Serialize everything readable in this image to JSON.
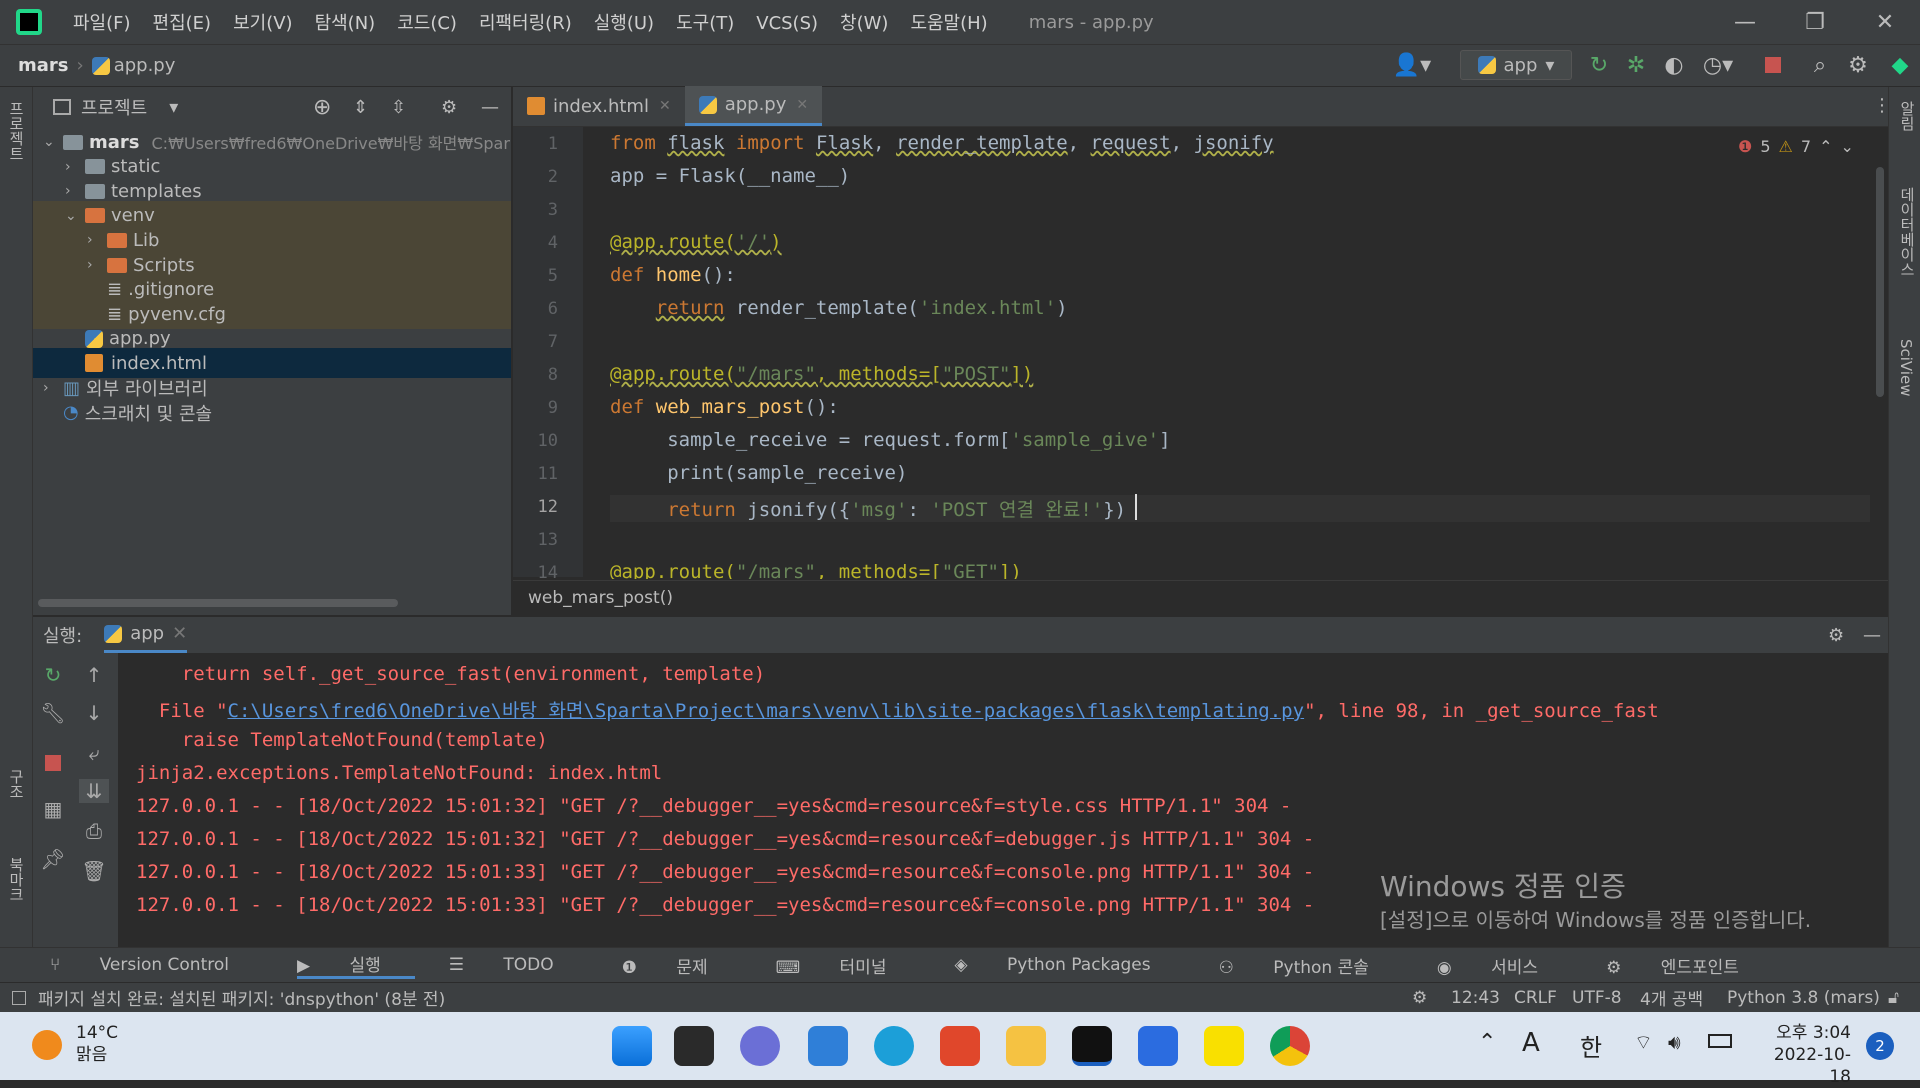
{
  "menu": [
    "파일(F)",
    "편집(E)",
    "보기(V)",
    "탐색(N)",
    "코드(C)",
    "리팩터링(R)",
    "실행(U)",
    "도구(T)",
    "VCS(S)",
    "창(W)",
    "도움말(H)"
  ],
  "window_title": "mars - app.py",
  "nav": {
    "project": "mars",
    "file": "app.py",
    "run_config": "app"
  },
  "project_panel": {
    "title": "프로젝트",
    "tree": [
      {
        "label": "mars",
        "path": "C:₩Users₩fred6₩OneDrive₩바탕 화면₩Spar",
        "level": 0,
        "type": "folder",
        "expanded": true
      },
      {
        "label": "static",
        "level": 1,
        "type": "folder"
      },
      {
        "label": "templates",
        "level": 1,
        "type": "folder"
      },
      {
        "label": "venv",
        "level": 1,
        "type": "folder-orange",
        "expanded": true
      },
      {
        "label": "Lib",
        "level": 2,
        "type": "folder-orange"
      },
      {
        "label": "Scripts",
        "level": 2,
        "type": "folder-orange"
      },
      {
        "label": ".gitignore",
        "level": 2,
        "type": "file"
      },
      {
        "label": "pyvenv.cfg",
        "level": 2,
        "type": "file"
      },
      {
        "label": "app.py",
        "level": 1,
        "type": "py"
      },
      {
        "label": "index.html",
        "level": 1,
        "type": "html",
        "selected": true
      },
      {
        "label": "외부 라이브러리",
        "level": 0,
        "type": "lib"
      },
      {
        "label": "스크래치 및 콘솔",
        "level": 0,
        "type": "scratch"
      }
    ]
  },
  "tabs": [
    {
      "label": "index.html"
    },
    {
      "label": "app.py",
      "active": true
    }
  ],
  "inspections": {
    "errors": "5",
    "warnings": "7"
  },
  "code_lines": [
    {
      "n": "1",
      "html": "<span class='kw'>from</span> <span class='un'>flask</span> <span class='kw'>import</span> <span class='un'>Flask</span>, <span class='un'>render_template</span>, <span class='un'>request</span>, <span class='un'>jsonify</span>"
    },
    {
      "n": "2",
      "html": "app = Flask(__name__)"
    },
    {
      "n": "3",
      "html": ""
    },
    {
      "n": "4",
      "html": "<span class='dec un'>@app.route(<span class='st'>'/'</span>)</span>"
    },
    {
      "n": "5",
      "html": "<span class='kw'>def</span> <span class='fn'>home</span>():"
    },
    {
      "n": "6",
      "html": "    <span class='kw un'>return</span> render_template(<span class='st'>'index.html'</span>)"
    },
    {
      "n": "7",
      "html": ""
    },
    {
      "n": "8",
      "html": "<span class='dec un'>@app.route(<span class='st'>\"/mars\"</span>, methods=[<span class='st'>\"POST\"</span>])</span>"
    },
    {
      "n": "9",
      "html": "<span class='kw'>def</span> <span class='fn'>web_mars_post</span>():"
    },
    {
      "n": "10",
      "html": "     sample_receive = request.form[<span class='st'>'sample_give'</span>]"
    },
    {
      "n": "11",
      "html": "     print(sample_receive)"
    },
    {
      "n": "12",
      "html": "     <span class='kw'>return</span> jsonify({<span class='st'>'msg'</span>: <span class='st'>'POST 연결 완료!'</span>})"
    },
    {
      "n": "13",
      "html": ""
    },
    {
      "n": "14",
      "html": "<span class='dec'>@app.route(<span class='st'>\"/mars\"</span>, methods=[<span class='st'>\"GET\"</span>])</span>"
    }
  ],
  "editor_breadcrumb": "web_mars_post()",
  "run": {
    "label": "실행:",
    "config": "app"
  },
  "log_lines": [
    {
      "html": "    return self._get_source_fast(environment, template)"
    },
    {
      "html": "  File \"<span class='link'>C:\\Users\\fred6\\OneDrive\\바탕 화면\\Sparta\\Project\\mars\\venv\\lib\\site-packages\\flask\\templating.py</span>\", line 98, in _get_source_fast"
    },
    {
      "html": "    raise TemplateNotFound(template)"
    },
    {
      "html": "jinja2.exceptions.TemplateNotFound: index.html"
    },
    {
      "html": "127.0.0.1 - - [18/Oct/2022 15:01:32] \"GET /?__debugger__=yes&amp;cmd=resource&amp;f=style.css HTTP/1.1\" 304 -"
    },
    {
      "html": "127.0.0.1 - - [18/Oct/2022 15:01:32] \"GET /?__debugger__=yes&amp;cmd=resource&amp;f=debugger.js HTTP/1.1\" 304 -"
    },
    {
      "html": "127.0.0.1 - - [18/Oct/2022 15:01:33] \"GET /?__debugger__=yes&amp;cmd=resource&amp;f=console.png HTTP/1.1\" 304 -"
    },
    {
      "html": "127.0.0.1 - - [18/Oct/2022 15:01:33] \"GET /?__debugger__=yes&amp;cmd=resource&amp;f=console.png HTTP/1.1\" 304 -"
    }
  ],
  "watermark": {
    "title": "Windows 정품 인증",
    "body": "[설정]으로 이동하여 Windows를 정품 인증합니다."
  },
  "tool_windows": [
    "Version Control",
    "실행",
    "TODO",
    "문제",
    "터미널",
    "Python Packages",
    "Python 콘솔",
    "서비스",
    "엔드포인트"
  ],
  "status": {
    "message": "패키지 설치 완료: 설치된 패키지: 'dnspython' (8분 전)",
    "position": "12:43",
    "line_sep": "CRLF",
    "encoding": "UTF-8",
    "indent": "4개 공백",
    "interpreter": "Python 3.8 (mars)"
  },
  "side_labels": {
    "left_top": "프로젝트",
    "left_mid": "구조",
    "left_bottom": "북마크",
    "right_notif": "알림",
    "right_db": "데이터베이스",
    "right_sci": "SciView"
  },
  "taskbar": {
    "temp": "14°C",
    "weather": "맑음",
    "ime": "A",
    "lang": "한",
    "time": "오후 3:04",
    "date": "2022-10-18",
    "notif_count": "2"
  },
  "colors": {
    "accent": "#4a88c7",
    "error": "#ff6b68",
    "link": "#5895dd"
  }
}
